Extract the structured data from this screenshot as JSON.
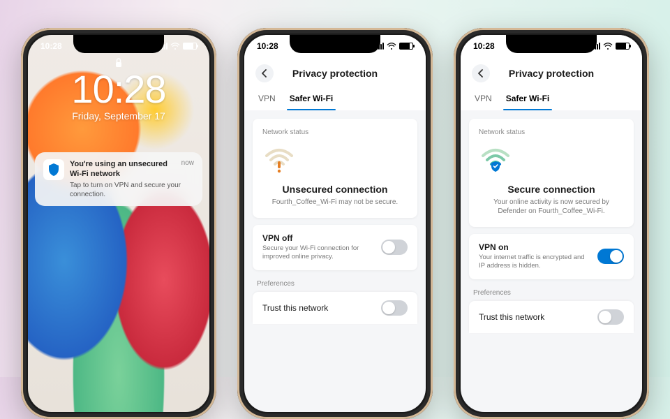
{
  "status": {
    "time": "10:28"
  },
  "lockscreen": {
    "time": "10:28",
    "date": "Friday, September 17",
    "notification": {
      "title": "You're using an unsecured Wi-Fi network",
      "body": "Tap to turn on VPN and secure your connection.",
      "timestamp": "now"
    }
  },
  "app": {
    "header": "Privacy protection",
    "tabs": {
      "vpn": "VPN",
      "safer": "Safer Wi-Fi"
    },
    "networkStatusLabel": "Network status",
    "preferencesLabel": "Preferences",
    "trustLabel": "Trust this network"
  },
  "screen2": {
    "connTitle": "Unsecured connection",
    "connSub": "Fourth_Coffee_Wi-Fi may not be secure.",
    "vpnTitle": "VPN off",
    "vpnSub": "Secure your Wi-Fi connection for improved online privacy."
  },
  "screen3": {
    "connTitle": "Secure connection",
    "connSub": "Your online activity is now secured by Defender on Fourth_Coffee_Wi-Fi.",
    "vpnTitle": "VPN on",
    "vpnSub": "Your internet traffic is encrypted and IP address is hidden."
  }
}
